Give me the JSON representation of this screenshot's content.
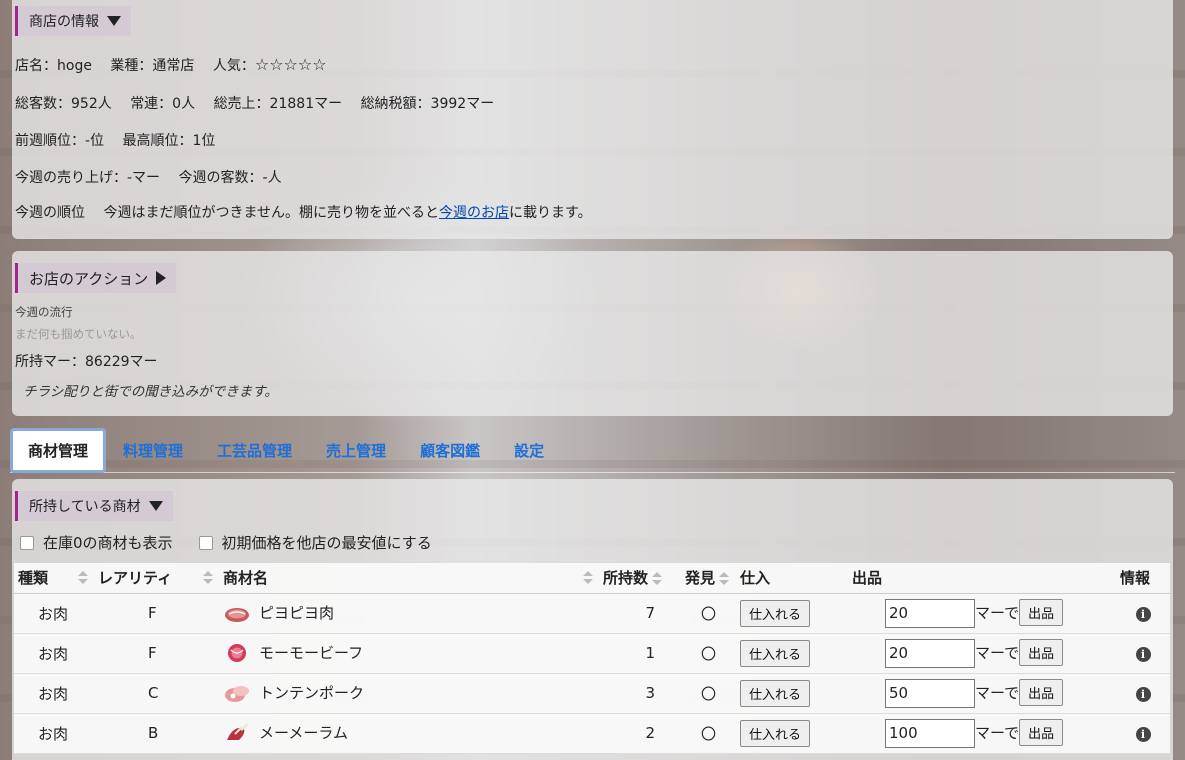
{
  "shop_info": {
    "section_title": "商店の情報",
    "line1": {
      "name": "店名：hoge",
      "type": "業種：通常店",
      "popularity_label": "人気：",
      "stars": "☆☆☆☆☆"
    },
    "line2": {
      "customers": "総客数：952人",
      "regulars": "常連：0人",
      "sales": "総売上：21881マー",
      "tax": "総納税額：3992マー"
    },
    "line3": {
      "last_rank": "前週順位：-位",
      "best_rank": "最高順位：1位"
    },
    "line4": {
      "week_sales": "今週の売り上げ：-マー",
      "week_customers": "今週の客数：-人"
    },
    "line5": {
      "label": "今週の順位",
      "text_before": "今週はまだ順位がつきません。棚に売り物を並べると",
      "link": "今週のお店",
      "text_after": "に載ります。"
    }
  },
  "shop_actions": {
    "section_title": "お店のアクション",
    "trend_label": "今週の流行",
    "trend_value": "まだ何も掴めていない。",
    "money": "所持マー：86229マー",
    "note": "チラシ配りと街での聞き込みができます。"
  },
  "tabs": [
    {
      "label": "商材管理",
      "active": true
    },
    {
      "label": "料理管理"
    },
    {
      "label": "工芸品管理"
    },
    {
      "label": "売上管理"
    },
    {
      "label": "顧客図鑑"
    },
    {
      "label": "設定"
    }
  ],
  "goods": {
    "section_title": "所持している商材",
    "option_zero_stock": "在庫0の商材も表示",
    "option_min_price": "初期価格を他店の最安値にする",
    "columns": {
      "kind": "種類",
      "rarity": "レアリティ",
      "name": "商材名",
      "owned": "所持数",
      "found": "発見",
      "stock": "仕入",
      "listing": "出品",
      "info": "情報"
    },
    "buy_button": "仕入れる",
    "list_button": "出品",
    "currency_suffix": "マーで",
    "rows": [
      {
        "kind": "お肉",
        "rarity": "F",
        "name": "ピヨピヨ肉",
        "owned": "7",
        "found": "〇",
        "price": "20",
        "icon": "meat-chicken-icon"
      },
      {
        "kind": "お肉",
        "rarity": "F",
        "name": "モーモービーフ",
        "owned": "1",
        "found": "〇",
        "price": "20",
        "icon": "meat-beef-icon"
      },
      {
        "kind": "お肉",
        "rarity": "C",
        "name": "トンテンポーク",
        "owned": "3",
        "found": "〇",
        "price": "50",
        "icon": "meat-pork-icon"
      },
      {
        "kind": "お肉",
        "rarity": "B",
        "name": "メーメーラム",
        "owned": "2",
        "found": "〇",
        "price": "100",
        "icon": "meat-lamb-icon"
      }
    ]
  },
  "colors": {
    "accent_bar": "#a2258f",
    "link": "#1f6fd6",
    "tab_border": "#8aa8d8"
  }
}
